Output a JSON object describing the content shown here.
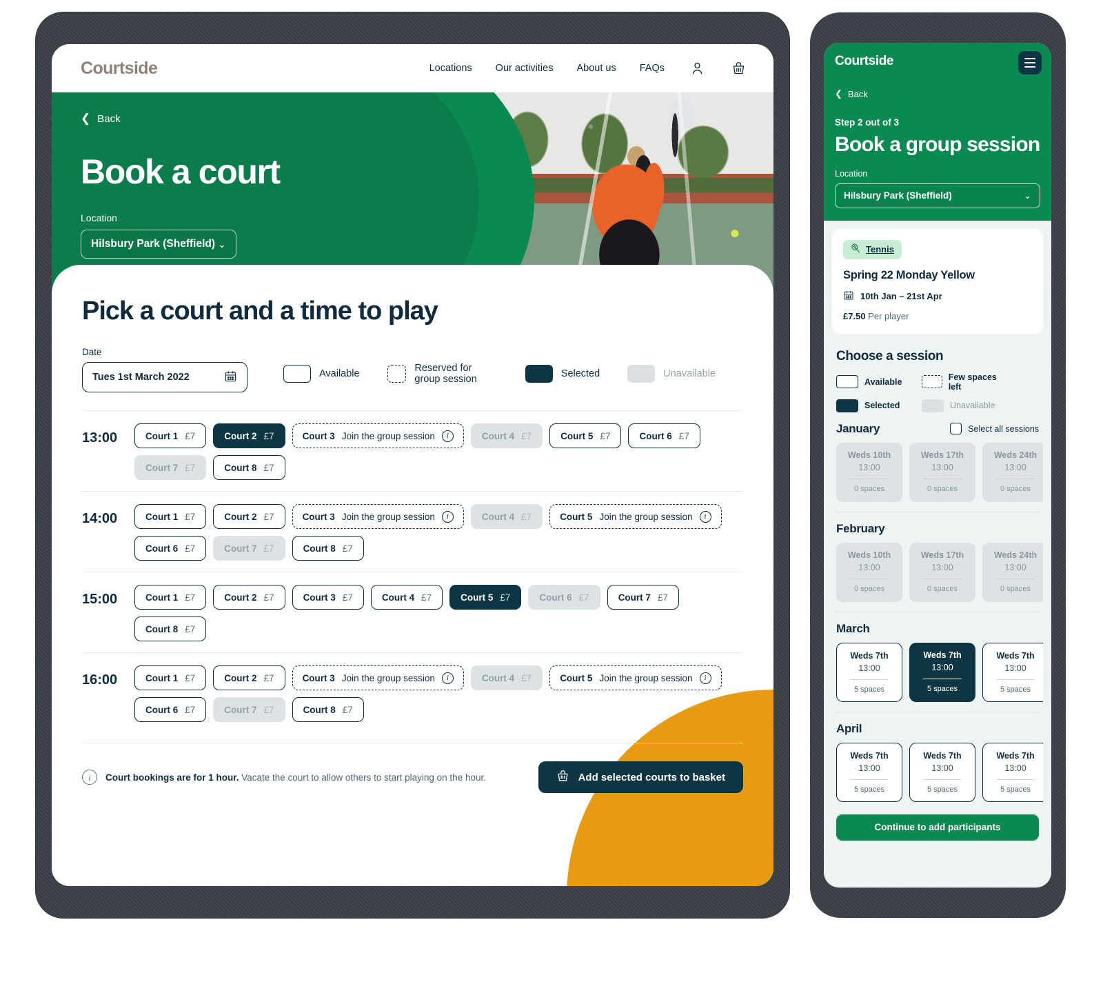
{
  "desktop": {
    "logo": "Courtside",
    "nav": [
      {
        "label": "Locations"
      },
      {
        "label": "Our activities"
      },
      {
        "label": "About us"
      },
      {
        "label": "FAQs"
      }
    ],
    "account_icon": "user-icon",
    "basket_icon": "basket-icon",
    "hero": {
      "back": "Back",
      "title": "Book a court",
      "location_label": "Location",
      "location_value": "Hilsbury Park (Sheffield)"
    },
    "page_title": "Pick a court and a time to play",
    "date": {
      "label": "Date",
      "value": "Tues 1st March 2022",
      "icon": "calendar-icon"
    },
    "legend": [
      {
        "label": "Available",
        "state": "available"
      },
      {
        "label": "Reserved for group session",
        "state": "reserved"
      },
      {
        "label": "Selected",
        "state": "selected"
      },
      {
        "label": "Unavailable",
        "state": "unavailable"
      }
    ],
    "group_session_text": "Join the group session",
    "price": "£7",
    "slots": [
      {
        "time": "13:00",
        "courts": [
          {
            "name": "Court 1",
            "state": "available"
          },
          {
            "name": "Court 2",
            "state": "selected"
          },
          {
            "name": "Court 3",
            "state": "group"
          },
          {
            "name": "Court 4",
            "state": "unavail"
          },
          {
            "name": "Court 5",
            "state": "available"
          },
          {
            "name": "Court 6",
            "state": "available"
          },
          {
            "name": "Court 7",
            "state": "unavail"
          },
          {
            "name": "Court 8",
            "state": "available"
          }
        ]
      },
      {
        "time": "14:00",
        "courts": [
          {
            "name": "Court 1",
            "state": "available"
          },
          {
            "name": "Court 2",
            "state": "available"
          },
          {
            "name": "Court 3",
            "state": "group"
          },
          {
            "name": "Court 4",
            "state": "unavail"
          },
          {
            "name": "Court 5",
            "state": "group"
          },
          {
            "name": "Court 6",
            "state": "available"
          },
          {
            "name": "Court 7",
            "state": "unavail"
          },
          {
            "name": "Court 8",
            "state": "available"
          }
        ]
      },
      {
        "time": "15:00",
        "courts": [
          {
            "name": "Court 1",
            "state": "available"
          },
          {
            "name": "Court 2",
            "state": "available"
          },
          {
            "name": "Court 3",
            "state": "available"
          },
          {
            "name": "Court 4",
            "state": "available"
          },
          {
            "name": "Court 5",
            "state": "selected"
          },
          {
            "name": "Court 6",
            "state": "unavail"
          },
          {
            "name": "Court 7",
            "state": "available"
          },
          {
            "name": "Court 8",
            "state": "available"
          }
        ]
      },
      {
        "time": "16:00",
        "courts": [
          {
            "name": "Court 1",
            "state": "available"
          },
          {
            "name": "Court 2",
            "state": "available"
          },
          {
            "name": "Court 3",
            "state": "group"
          },
          {
            "name": "Court 4",
            "state": "unavail"
          },
          {
            "name": "Court 5",
            "state": "group"
          },
          {
            "name": "Court 6",
            "state": "available"
          },
          {
            "name": "Court 7",
            "state": "unavail"
          },
          {
            "name": "Court 8",
            "state": "available"
          }
        ]
      }
    ],
    "footer": {
      "note_bold": "Court bookings are for 1 hour.",
      "note_rest": " Vacate the court to allow others to start playing on the hour.",
      "basket_button": "Add selected courts to basket"
    }
  },
  "phone": {
    "logo": "Courtside",
    "menu_icon": "hamburger-icon",
    "back": "Back",
    "step": "Step 2 out of 3",
    "title": "Book a group session",
    "location_label": "Location",
    "location_value": "Hilsbury Park (Sheffield)",
    "session": {
      "tag": "Tennis",
      "tag_icon": "tennis-racket-icon",
      "name": "Spring 22 Monday Yellow",
      "dates": "10th Jan – 21st Apr",
      "dates_icon": "calendar-icon",
      "price": "£7.50",
      "price_unit": "Per player"
    },
    "choose_heading": "Choose a session",
    "legend": [
      {
        "label": "Available",
        "state": "available"
      },
      {
        "label": "Few spaces left",
        "state": "reserved"
      },
      {
        "label": "Selected",
        "state": "selected"
      },
      {
        "label": "Unavailable",
        "state": "unavailable"
      }
    ],
    "select_all": "Select all sessions",
    "months": [
      {
        "name": "January",
        "show_select_all": true,
        "sessions": [
          {
            "day": "Weds 10th",
            "time": "13:00",
            "spaces": "0 spaces",
            "state": "unavail"
          },
          {
            "day": "Weds 17th",
            "time": "13:00",
            "spaces": "0 spaces",
            "state": "unavail"
          },
          {
            "day": "Weds 24th",
            "time": "13:00",
            "spaces": "0 spaces",
            "state": "unavail"
          }
        ]
      },
      {
        "name": "February",
        "show_select_all": false,
        "sessions": [
          {
            "day": "Weds 10th",
            "time": "13:00",
            "spaces": "0 spaces",
            "state": "unavail"
          },
          {
            "day": "Weds 17th",
            "time": "13:00",
            "spaces": "0 spaces",
            "state": "unavail"
          },
          {
            "day": "Weds 24th",
            "time": "13:00",
            "spaces": "0 spaces",
            "state": "unavail"
          }
        ]
      },
      {
        "name": "March",
        "show_select_all": false,
        "sessions": [
          {
            "day": "Weds 7th",
            "time": "13:00",
            "spaces": "5 spaces",
            "state": "avail"
          },
          {
            "day": "Weds 7th",
            "time": "13:00",
            "spaces": "5 spaces",
            "state": "sel"
          },
          {
            "day": "Weds 7th",
            "time": "13:00",
            "spaces": "5 spaces",
            "state": "avail"
          }
        ]
      },
      {
        "name": "April",
        "show_select_all": false,
        "sessions": [
          {
            "day": "Weds 7th",
            "time": "13:00",
            "spaces": "5 spaces",
            "state": "avail"
          },
          {
            "day": "Weds 7th",
            "time": "13:00",
            "spaces": "5 spaces",
            "state": "avail"
          },
          {
            "day": "Weds 7th",
            "time": "13:00",
            "spaces": "5 spaces",
            "state": "avail"
          }
        ]
      }
    ],
    "continue_button": "Continue to add participants"
  },
  "colors": {
    "green": "#0a8a52",
    "dark_navy": "#0c3644",
    "navy_text": "#0f2b3d",
    "orange": "#e99a14",
    "unavailable_grey": "#dde2e4",
    "logo_brown": "#8d8278"
  }
}
